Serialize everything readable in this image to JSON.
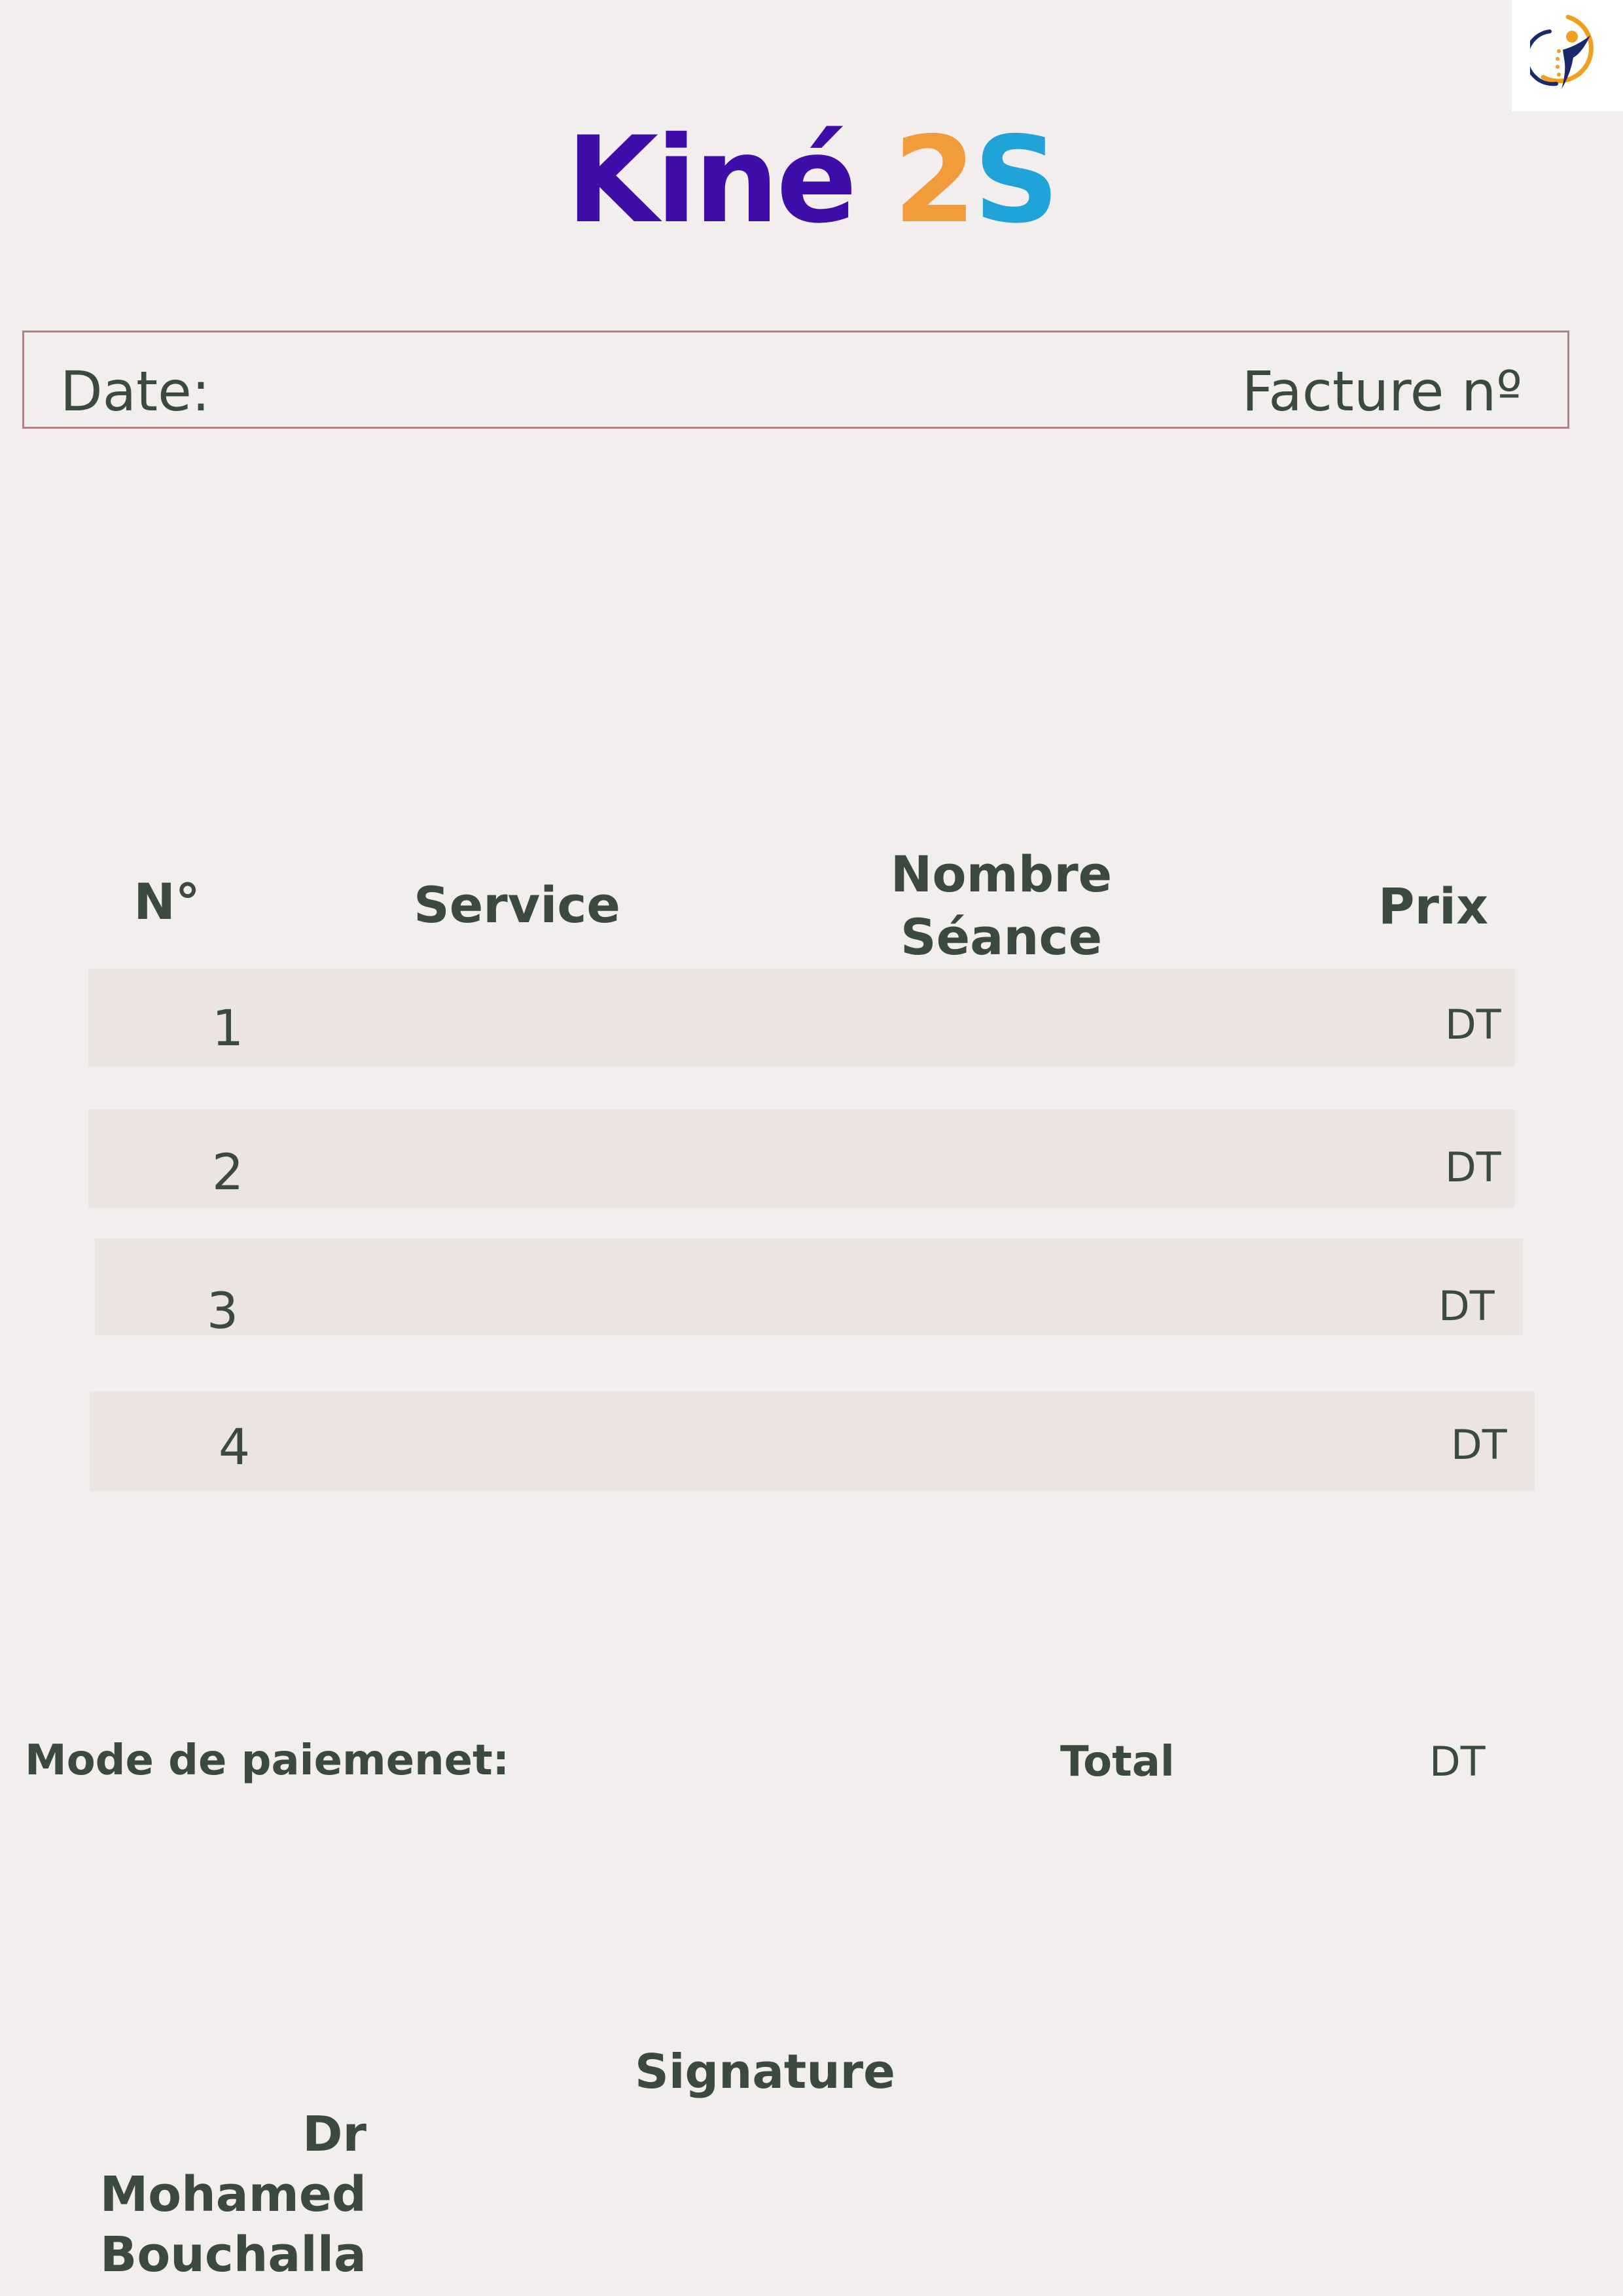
{
  "logo": {
    "icon": "spine-figure-icon",
    "colors": {
      "ring": "#f0a020",
      "figure": "#1a2a6c"
    }
  },
  "title": {
    "word": "Kiné",
    "two": "2",
    "s": "S",
    "colors": {
      "word": "#3f0ea8",
      "two": "#f29b3a",
      "s": "#1fa3d8"
    }
  },
  "info": {
    "date_label": "Date:",
    "invoice_label": "Facture nº"
  },
  "table": {
    "headers": {
      "no": "N°",
      "service": "Service",
      "sessions_line1": "Nombre",
      "sessions_line2": "Séance",
      "price": "Prix"
    },
    "rows": [
      {
        "no": "1",
        "currency": "DT"
      },
      {
        "no": "2",
        "currency": "DT"
      },
      {
        "no": "3",
        "currency": "DT"
      },
      {
        "no": "4",
        "currency": "DT"
      }
    ]
  },
  "footer": {
    "payment_label": "Mode de paiemenet:",
    "total_label": "Total",
    "total_currency": "DT",
    "signature_label": "Signature",
    "doctor_line1": "Dr Mohamed",
    "doctor_line2": "Bouchalla"
  },
  "colors": {
    "background": "#f2eeed",
    "row_fill": "#ece3e3",
    "text": "#3b4a3f",
    "box_border": "#b57f86"
  }
}
